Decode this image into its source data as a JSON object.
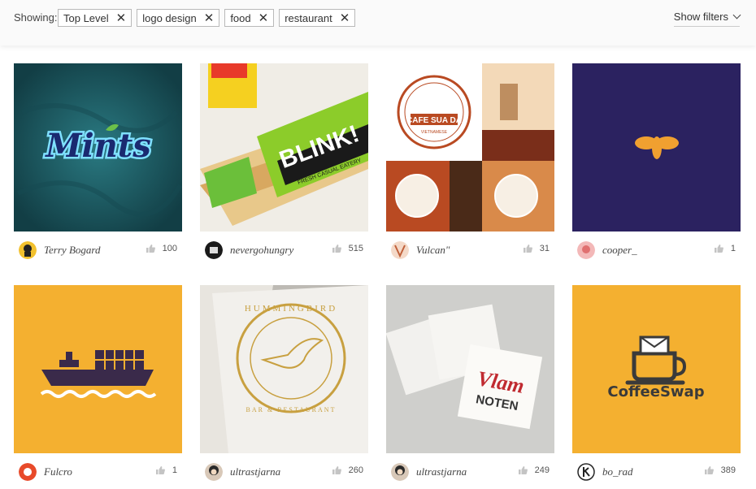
{
  "filters": {
    "showing_label": "Showing:",
    "chips": [
      "Top Level",
      "logo design",
      "food",
      "restaurant"
    ],
    "show_filters_label": "Show filters"
  },
  "cards": [
    {
      "username": "Terry Bogard",
      "likes": "100",
      "art_text": "Mints",
      "bg": "#1e5a63"
    },
    {
      "username": "nevergohungry",
      "likes": "515",
      "art_text": "BLINK!",
      "art_sub": "FRESH CASUAL EATERY",
      "bg": "#f0ede6"
    },
    {
      "username": "Vulcan\"",
      "likes": "31",
      "art_text": "CAFE SUA DA",
      "art_sub": "VIETNAMESE",
      "bg": "#c85a2a"
    },
    {
      "username": "cooper_",
      "likes": "1",
      "bg": "#2b2260"
    },
    {
      "username": "Fulcro",
      "likes": "1",
      "bg": "#f4b030"
    },
    {
      "username": "ultrastjarna",
      "likes": "260",
      "art_text": "HUMMINGBIRD",
      "art_sub": "BAR & RESTAURANT",
      "bg": "#d9d6d0"
    },
    {
      "username": "ultrastjarna",
      "likes": "249",
      "art_text": "Vlam",
      "art_sub": "NOTEN",
      "bg": "#cfcfcc"
    },
    {
      "username": "bo_rad",
      "likes": "389",
      "art_text": "CoffeeSwap",
      "bg": "#f4b030"
    }
  ]
}
